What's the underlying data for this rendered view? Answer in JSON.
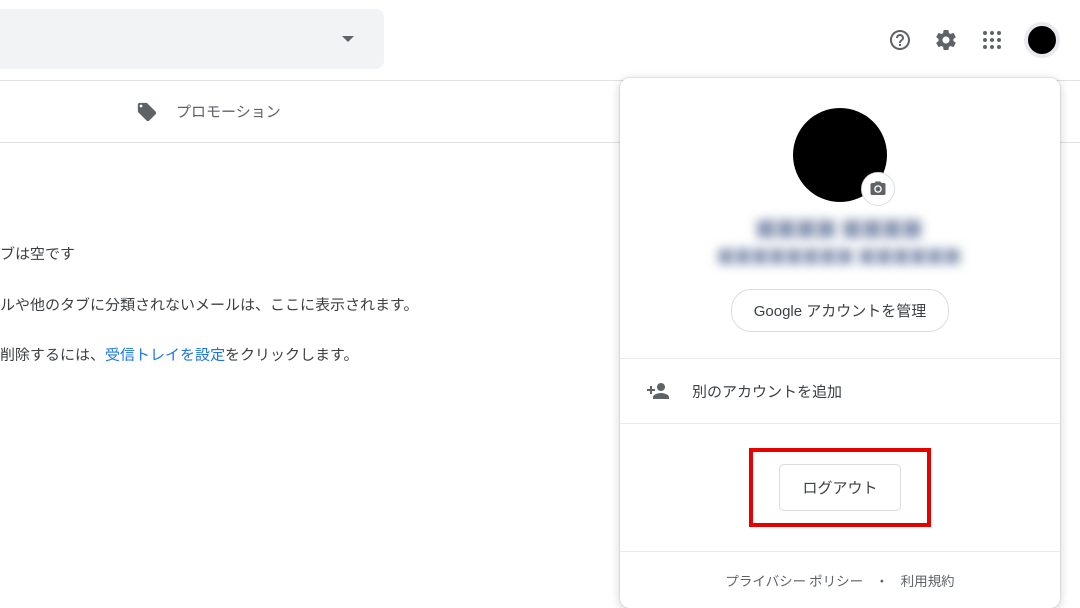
{
  "tabs": {
    "promotions": "プロモーション"
  },
  "emptyState": {
    "line1": "ブは空です",
    "line2": "ルや他のタブに分類されないメールは、ここに表示されます。",
    "line3_pre": "削除するには、",
    "line3_link": "受信トレイを設定",
    "line3_post": "をクリックします。"
  },
  "accountPopup": {
    "userName": "████ ████",
    "userEmail": "████████ ██████",
    "manageAccount": "Google アカウントを管理",
    "addAccount": "別のアカウントを追加",
    "logout": "ログアウト",
    "privacyPolicy": "プライバシー ポリシー",
    "separator": "・",
    "terms": "利用規約"
  }
}
